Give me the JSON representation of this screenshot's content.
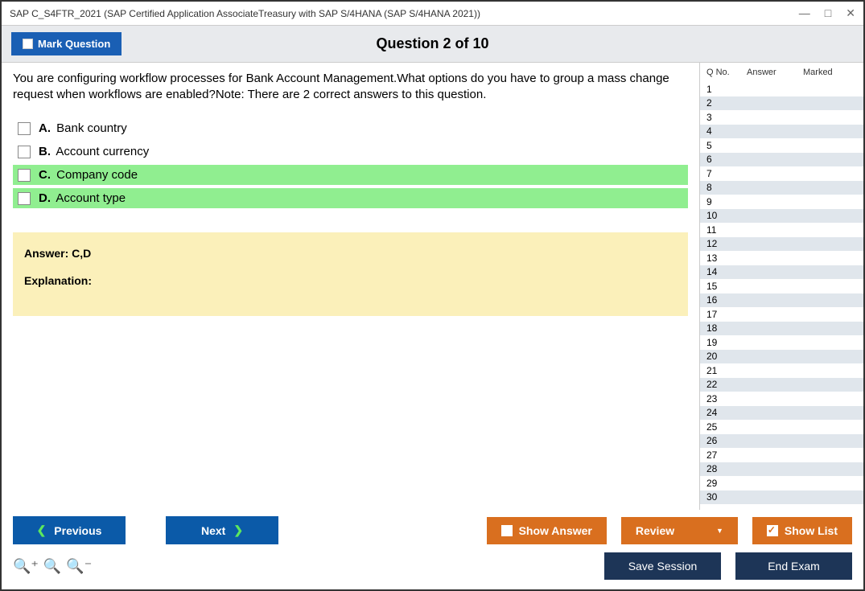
{
  "window": {
    "title": "SAP C_S4FTR_2021 (SAP Certified Application AssociateTreasury with SAP S/4HANA (SAP S/4HANA 2021))"
  },
  "header": {
    "markQuestion": "Mark Question",
    "questionTitle": "Question 2 of 10"
  },
  "question": {
    "text": "You are configuring workflow processes for Bank Account Management.What options do you have to group a mass change request when workflows are enabled?Note: There are 2 correct answers to this question.",
    "options": [
      {
        "letter": "A.",
        "text": "Bank country",
        "correct": false
      },
      {
        "letter": "B.",
        "text": "Account currency",
        "correct": false
      },
      {
        "letter": "C.",
        "text": "Company code",
        "correct": true
      },
      {
        "letter": "D.",
        "text": "Account type",
        "correct": true
      }
    ]
  },
  "answer": {
    "line": "Answer: C,D",
    "explanationLabel": "Explanation:",
    "explanationText": ""
  },
  "sidebar": {
    "headers": {
      "qno": "Q No.",
      "answer": "Answer",
      "marked": "Marked"
    },
    "rows": [
      {
        "n": "1"
      },
      {
        "n": "2"
      },
      {
        "n": "3"
      },
      {
        "n": "4"
      },
      {
        "n": "5"
      },
      {
        "n": "6"
      },
      {
        "n": "7"
      },
      {
        "n": "8"
      },
      {
        "n": "9"
      },
      {
        "n": "10"
      },
      {
        "n": "11"
      },
      {
        "n": "12"
      },
      {
        "n": "13"
      },
      {
        "n": "14"
      },
      {
        "n": "15"
      },
      {
        "n": "16"
      },
      {
        "n": "17"
      },
      {
        "n": "18"
      },
      {
        "n": "19"
      },
      {
        "n": "20"
      },
      {
        "n": "21"
      },
      {
        "n": "22"
      },
      {
        "n": "23"
      },
      {
        "n": "24"
      },
      {
        "n": "25"
      },
      {
        "n": "26"
      },
      {
        "n": "27"
      },
      {
        "n": "28"
      },
      {
        "n": "29"
      },
      {
        "n": "30"
      }
    ]
  },
  "footer": {
    "previous": "Previous",
    "next": "Next",
    "showAnswer": "Show Answer",
    "review": "Review",
    "showList": "Show List",
    "saveSession": "Save Session",
    "endExam": "End Exam"
  }
}
